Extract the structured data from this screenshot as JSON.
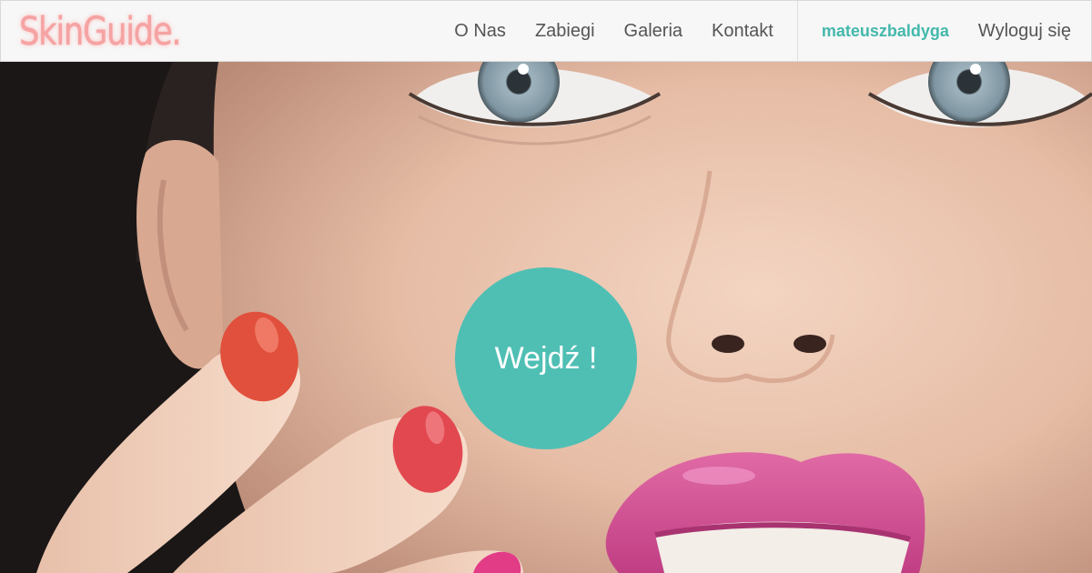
{
  "brand": {
    "name": "SkinGuide."
  },
  "nav": {
    "items": [
      {
        "label": "O Nas"
      },
      {
        "label": "Zabiegi"
      },
      {
        "label": "Galeria"
      },
      {
        "label": "Kontakt"
      }
    ],
    "user": "mateuszbaldyga",
    "logout": "Wyloguj się"
  },
  "hero": {
    "cta_label": "Wejdź !"
  },
  "colors": {
    "brand": "#f5a3a3",
    "accent": "#4fbfb4",
    "nav_text": "#555555",
    "nav_bg": "#f7f7f7"
  }
}
